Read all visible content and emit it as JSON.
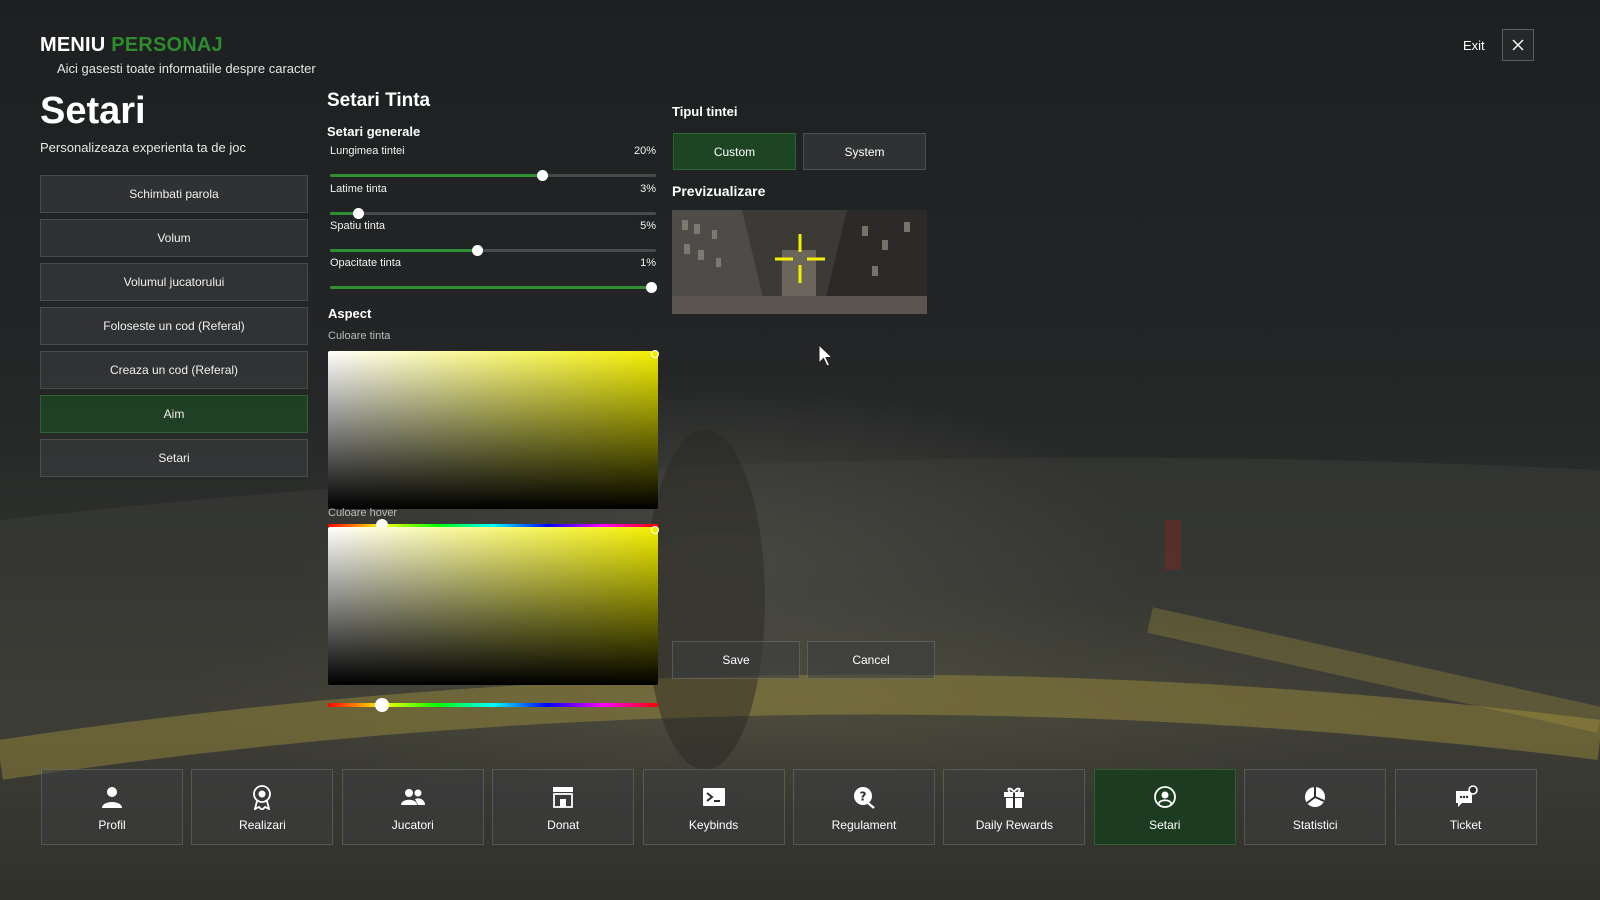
{
  "header": {
    "title_main": "MENIU",
    "title_accent": "PERSONAJ",
    "subtitle": "Aici gasesti toate informatiile despre caracter",
    "exit_label": "Exit"
  },
  "left": {
    "title": "Setari",
    "subtitle": "Personalizeaza experienta ta de joc",
    "menu": [
      {
        "label": "Schimbati parola",
        "active": false
      },
      {
        "label": "Volum",
        "active": false
      },
      {
        "label": "Volumul jucatorului",
        "active": false
      },
      {
        "label": "Foloseste un cod (Referal)",
        "active": false
      },
      {
        "label": "Creaza un cod (Referal)",
        "active": false
      },
      {
        "label": "Aim",
        "active": true
      },
      {
        "label": "Setari",
        "active": false
      }
    ]
  },
  "crosshair": {
    "title": "Setari Tinta",
    "general_heading": "Setari generale",
    "sliders": [
      {
        "label": "Lungimea tintei",
        "value": "20%",
        "position": 0.65
      },
      {
        "label": "Latime tinta",
        "value": "3%",
        "position": 0.085
      },
      {
        "label": "Spatiu tinta",
        "value": "5%",
        "position": 0.45
      },
      {
        "label": "Opacitate tinta",
        "value": "1%",
        "position": 0.985
      }
    ],
    "aspect_heading": "Aspect",
    "color_label": "Culoare tinta",
    "hover_label": "Culoare hover",
    "color_value": "#f3f000",
    "hover_value": "#f3f000",
    "hue_position": 0.165
  },
  "type": {
    "heading": "Tipul tintei",
    "options": [
      {
        "label": "Custom",
        "active": true
      },
      {
        "label": "System",
        "active": false
      }
    ],
    "preview_heading": "Previzualizare",
    "crosshair_color": "#f3f000"
  },
  "actions": {
    "save": "Save",
    "cancel": "Cancel"
  },
  "nav": [
    {
      "label": "Profil",
      "icon": "user-icon",
      "active": false
    },
    {
      "label": "Realizari",
      "icon": "award-icon",
      "active": false
    },
    {
      "label": "Jucatori",
      "icon": "users-icon",
      "active": false
    },
    {
      "label": "Donat",
      "icon": "store-icon",
      "active": false
    },
    {
      "label": "Keybinds",
      "icon": "terminal-icon",
      "active": false
    },
    {
      "label": "Regulament",
      "icon": "rules-icon",
      "active": false
    },
    {
      "label": "Daily Rewards",
      "icon": "gift-icon",
      "active": false
    },
    {
      "label": "Setari",
      "icon": "user-circle-icon",
      "active": true
    },
    {
      "label": "Statistici",
      "icon": "pie-chart-icon",
      "active": false
    },
    {
      "label": "Ticket",
      "icon": "ticket-chat-icon",
      "active": false
    }
  ],
  "colors": {
    "accent": "#2e8b2e",
    "active_bg": "#1e4b23"
  }
}
